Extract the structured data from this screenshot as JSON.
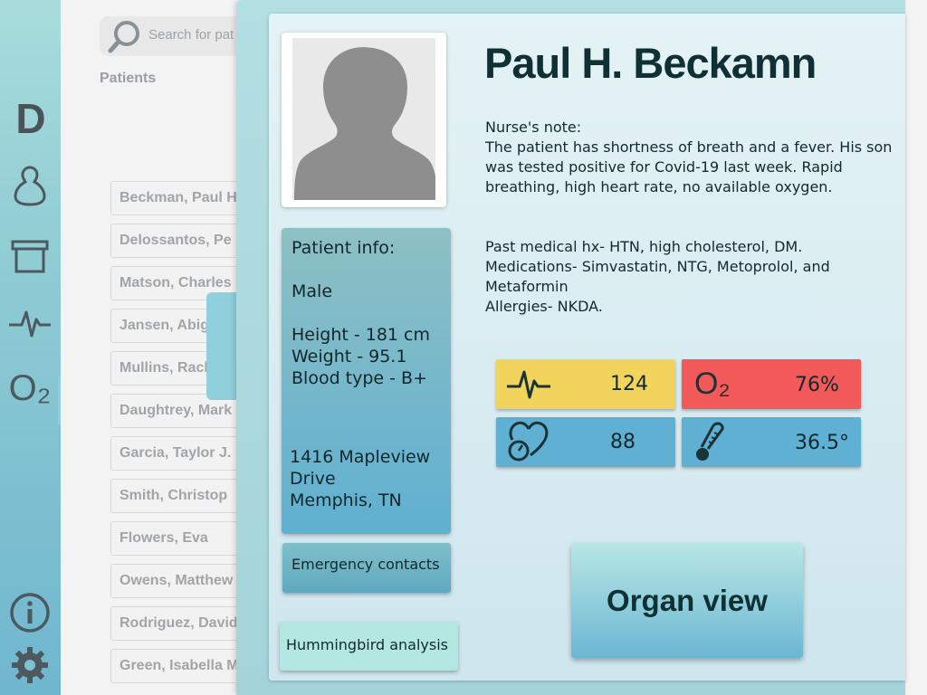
{
  "rail": {
    "logo": "D",
    "items": [
      {
        "icon": "person-icon"
      },
      {
        "icon": "archive-box-icon"
      },
      {
        "icon": "heartbeat-icon"
      },
      {
        "icon": "oxygen-icon",
        "label": "O₂"
      },
      {
        "icon": "info-icon"
      },
      {
        "icon": "gear-icon"
      }
    ]
  },
  "search": {
    "placeholder": "Search for pat",
    "icon": "search-icon"
  },
  "patients": {
    "title": "Patients",
    "items": [
      "Beckman, Paul H",
      "Delossantos, Pe",
      "Matson, Charles",
      "Jansen, Abig",
      "Mullins, Rack",
      "Daughtrey, Mark",
      "Garcia, Taylor J.",
      "Smith, Christop",
      "Flowers, Eva",
      "Owens, Matthew",
      "Rodriguez, David",
      "Green, Isabella M"
    ]
  },
  "patient": {
    "name": "Paul H. Beckamn",
    "note_title": "Nurse's note:",
    "note_text": "The patient has shortness of breath and a fever. His son was tested positive for Covid-19 last week. Rapid breathing, high heart rate, no available oxygen.",
    "history": [
      "Past medical hx- HTN, high cholesterol, DM.",
      "Medications- Simvastatin, NTG, Metoprolol, and Metaformin",
      "Allergies- NKDA."
    ],
    "info": {
      "title": "Patient info:",
      "sex": "Male",
      "height": "Height - 181 cm",
      "weight": "Weight - 95.1",
      "blood": "Blood type - B+",
      "address_1": "1416 Mapleview",
      "address_2": "Drive",
      "address_3": "Memphis, TN"
    },
    "vitals": {
      "heart_rate": {
        "value": "124",
        "icon": "heartbeat-icon",
        "color": "#f2d45c"
      },
      "oxygen": {
        "value": "76%",
        "icon": "oxygen-icon",
        "label": "O₂",
        "color": "#f25a5a"
      },
      "blood_pressure": {
        "value": "88",
        "icon": "heart-gauge-icon",
        "color": "#5fb0d3"
      },
      "temperature": {
        "value": "36.5°",
        "icon": "thermometer-icon",
        "color": "#5fb0d3"
      }
    }
  },
  "buttons": {
    "emergency": "Emergency contacts",
    "hummingbird": "Hummingbird analysis",
    "organ_view": "Organ view"
  },
  "colors": {
    "rail_accent": "#8fd0dc",
    "heart_rate_tile": "#f2d45c",
    "oxygen_tile": "#f25a5a",
    "vitals_tile": "#5fb0d3",
    "hummingbird_button": "#b2e7e2"
  }
}
